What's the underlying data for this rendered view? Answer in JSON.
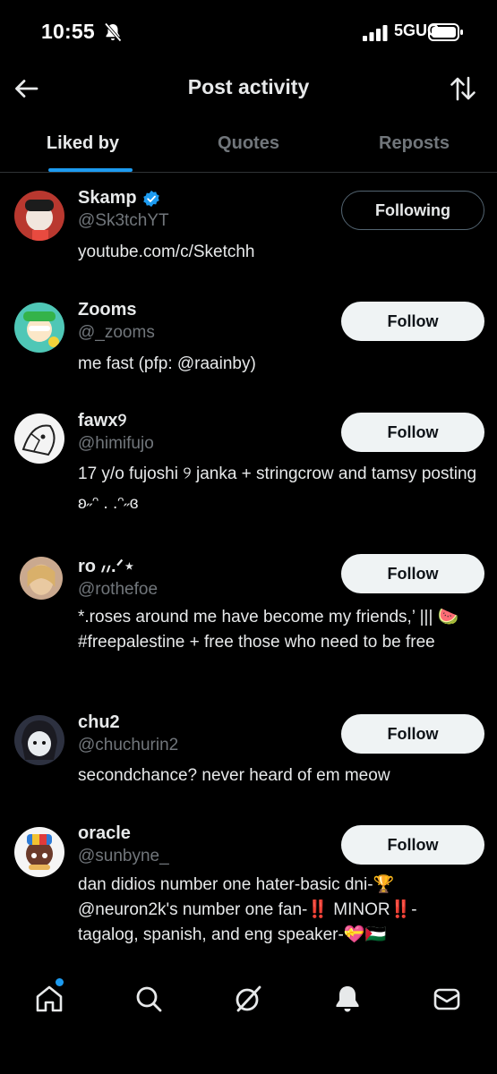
{
  "status": {
    "time": "10:55",
    "network": "5GUC"
  },
  "header": {
    "title": "Post activity"
  },
  "tabs": [
    {
      "label": "Liked by",
      "active": true
    },
    {
      "label": "Quotes",
      "active": false
    },
    {
      "label": "Reposts",
      "active": false
    }
  ],
  "users": [
    {
      "name": "Skamp",
      "verified": true,
      "handle": "@Sk3tchYT",
      "bio": "youtube.com/c/Sketchh",
      "button": "Following"
    },
    {
      "name": "Zooms",
      "verified": false,
      "handle": "@_zooms",
      "bio": "me fast (pfp: @raainby)",
      "button": "Follow"
    },
    {
      "name": "fawx୨",
      "verified": false,
      "handle": "@himifujo",
      "bio": "17 y/o fujoshi ୨ janka + stringcrow and tamsy posting ʚ˶ᵔ . .ᵔ˶ɞ",
      "button": "Follow"
    },
    {
      "name": "ro ៸៸.ᐟ⋆",
      "verified": false,
      "handle": "@rothefoe",
      "bio": "*.roses around me have become my friends,’ ||| 🍉 #freepalestine + free those who need to be free",
      "button": "Follow"
    },
    {
      "name": "chu2",
      "verified": false,
      "handle": "@chuchurin2",
      "bio": "secondchance? never heard of em meow",
      "button": "Follow"
    },
    {
      "name": "oracle",
      "verified": false,
      "handle": "@sunbyne_",
      "bio": "dan didios number one hater-basic dni-🏆 @neuron2k's number one fan-‼️ MINOR‼️-tagalog, spanish, and eng speaker-💝🇵🇸",
      "button": "Follow"
    }
  ],
  "colors": {
    "accent": "#1d9bf0",
    "background": "#000000",
    "secondary_text": "#71767b"
  },
  "icons": [
    "home-icon",
    "search-icon",
    "grok-icon",
    "notifications-icon",
    "messages-icon"
  ]
}
